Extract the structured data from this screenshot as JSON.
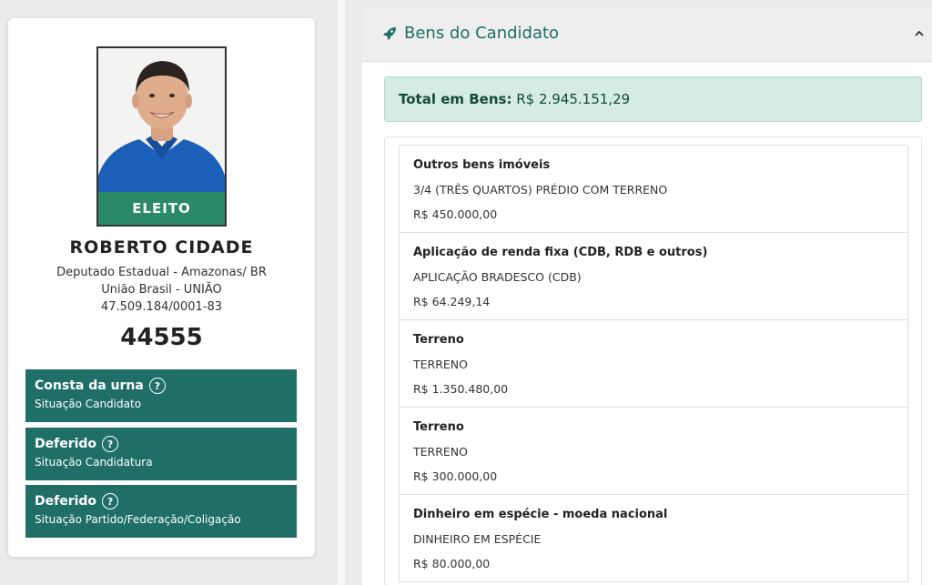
{
  "candidate": {
    "badge": "ELEITO",
    "name": "ROBERTO CIDADE",
    "office": "Deputado Estadual - Amazonas/ BR",
    "party": "União Brasil - UNIÃO",
    "cnpj": "47.509.184/0001-83",
    "number": "44555"
  },
  "statuses": [
    {
      "title": "Consta da urna",
      "subtitle": "Situação Candidato",
      "help_icon": "?"
    },
    {
      "title": "Deferido",
      "subtitle": "Situação Candidatura",
      "help_icon": "?"
    },
    {
      "title": "Deferido",
      "subtitle": "Situação Partido/Federação/Coligação",
      "help_icon": "?"
    }
  ],
  "panel": {
    "title": "Bens do Candidato",
    "header_icon": "rocket-icon",
    "collapse_icon": "chevron-up-icon",
    "total_label": "Total em Bens:",
    "total_value": "R$ 2.945.151,29"
  },
  "assets": [
    {
      "type": "Outros bens imóveis",
      "description": "3/4 (TRÊS QUARTOS) PRÉDIO COM TERRENO",
      "value": "R$ 450.000,00"
    },
    {
      "type": "Aplicação de renda fixa (CDB, RDB e outros)",
      "description": "APLICAÇÃO BRADESCO (CDB)",
      "value": "R$ 64.249,14"
    },
    {
      "type": "Terreno",
      "description": "TERRENO",
      "value": "R$ 1.350.480,00"
    },
    {
      "type": "Terreno",
      "description": "TERRENO",
      "value": "R$ 300.000,00"
    },
    {
      "type": "Dinheiro em espécie - moeda nacional",
      "description": "DINHEIRO EM ESPÉCIE",
      "value": "R$ 80.000,00"
    }
  ],
  "colors": {
    "accent_teal": "#1f6e68",
    "elected_green": "#2a8a68",
    "total_bg": "#d4ece1"
  }
}
